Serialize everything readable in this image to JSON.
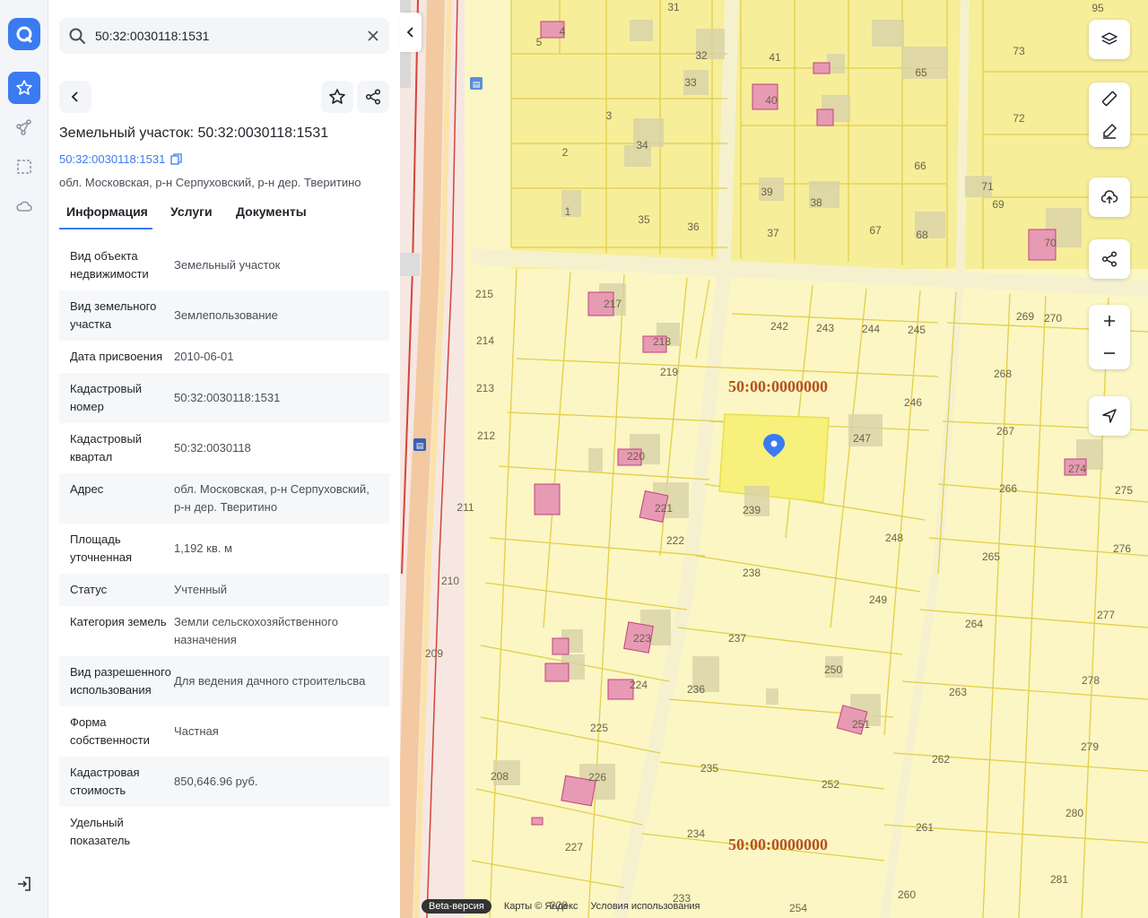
{
  "search": {
    "value": "50:32:0030118:1531"
  },
  "card": {
    "title": "Земельный участок: 50:32:0030118:1531",
    "cadastral_link": "50:32:0030118:1531",
    "address_line": "обл. Московская, р-н Серпуховский, р-н дер. Тверитино"
  },
  "tabs": [
    {
      "label": "Информация",
      "active": true
    },
    {
      "label": "Услуги",
      "active": false
    },
    {
      "label": "Документы",
      "active": false
    }
  ],
  "properties": [
    {
      "key": "Вид объекта недвижимости",
      "value": "Земельный участок"
    },
    {
      "key": "Вид земельного участка",
      "value": "Землепользование"
    },
    {
      "key": "Дата присвоения",
      "value": "2010-06-01"
    },
    {
      "key": "Кадастровый номер",
      "value": "50:32:0030118:1531"
    },
    {
      "key": "Кадастровый квартал",
      "value": "50:32:0030118"
    },
    {
      "key": "Адрес",
      "value": "обл. Московская, р-н Серпуховский, р-н дер. Тверитино"
    },
    {
      "key": "Площадь уточненная",
      "value": "1,192 кв. м"
    },
    {
      "key": "Статус",
      "value": "Учтенный"
    },
    {
      "key": "Категория земель",
      "value": "Земли сельскохозяйственного назначения"
    },
    {
      "key": "Вид разрешенного использования",
      "value": "Для ведения дачного строительсва"
    },
    {
      "key": "Форма собственности",
      "value": "Частная"
    },
    {
      "key": "Кадастровая стоимость",
      "value": "850,646.96 руб."
    },
    {
      "key": "Удельный показатель",
      "value": ""
    }
  ],
  "map": {
    "zone_labels": [
      "50:00:0000000",
      "50:00:0000000"
    ],
    "plot_numbers": [
      "31",
      "32",
      "33",
      "34",
      "41",
      "40",
      "65",
      "73",
      "72",
      "66",
      "2",
      "1",
      "35",
      "36",
      "39",
      "38",
      "37",
      "67",
      "68",
      "71",
      "69",
      "70",
      "95",
      "215",
      "214",
      "213",
      "212",
      "211",
      "210",
      "209",
      "208",
      "217",
      "218",
      "219",
      "220",
      "221",
      "222",
      "223",
      "224",
      "225",
      "226",
      "227",
      "228",
      "242",
      "243",
      "244",
      "245",
      "246",
      "247",
      "239",
      "238",
      "237",
      "236",
      "235",
      "234",
      "233",
      "248",
      "249",
      "250",
      "251",
      "252",
      "254",
      "269",
      "270",
      "268",
      "267",
      "266",
      "265",
      "264",
      "263",
      "262",
      "261",
      "260",
      "281",
      "280",
      "279",
      "278",
      "277",
      "276",
      "275",
      "274",
      "5",
      "3",
      "4"
    ],
    "footer": {
      "beta": "Beta-версия",
      "copyright": "Карты © Яндекс",
      "terms": "Условия использования"
    }
  },
  "colors": {
    "accent": "#3a7bf2",
    "parcel_fill": "#fbf6c4",
    "parcel_line": "#e2cf4a",
    "building": "#e79ab4",
    "zone_label": "#b5521e"
  }
}
